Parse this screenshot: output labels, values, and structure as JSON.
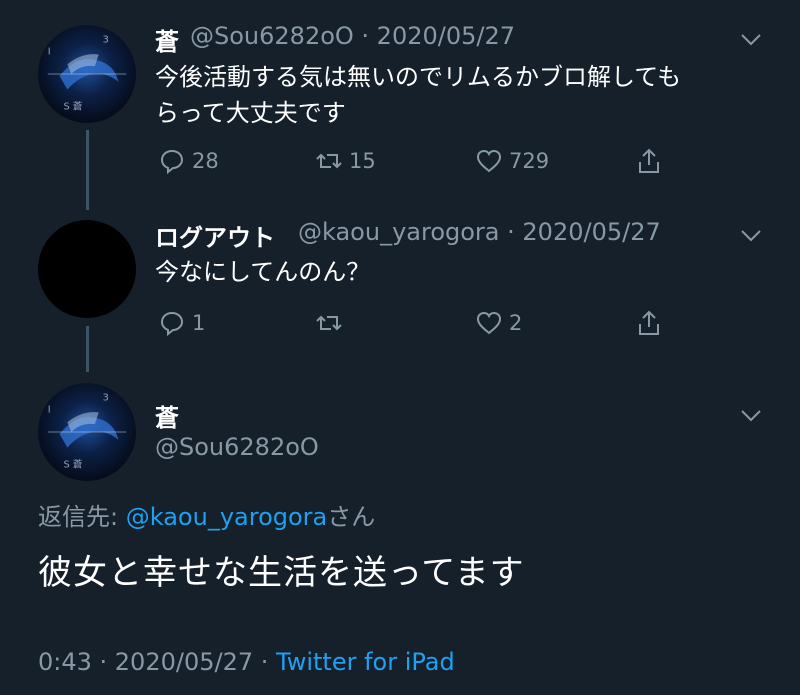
{
  "tweet1": {
    "name": "蒼",
    "handle": "@Sou6282oO",
    "date": "· 2020/05/27",
    "line1": "今後活動する気は無いのでリムるかブロ解しても",
    "line2": "らって大丈夫です",
    "reply_count": "28",
    "retweet_count": "15",
    "like_count": "729"
  },
  "tweet2": {
    "name": "ログアウト",
    "handle": "@kaou_yarogora",
    "date": "· 2020/05/27",
    "text": "今なにしてんのん？",
    "reply_count": "1",
    "retweet_count": "",
    "like_count": "2"
  },
  "main_tweet": {
    "name": "蒼",
    "handle": "@Sou6282oO",
    "replying_prefix": "返信先:",
    "replying_user": "@kaou_yarogora",
    "replying_suffix": "さん",
    "text": "彼女と幸せな生活を送ってます",
    "time": "0:43 · 2020/05/27 ·",
    "client": "Twitter for iPad"
  },
  "colors": {
    "background": "#15202b",
    "muted": "#8899a6",
    "accent": "#1da1f2",
    "thread_line": "#3d5466"
  },
  "icons": [
    "chevron-down-icon",
    "reply-icon",
    "retweet-icon",
    "like-icon",
    "share-icon"
  ]
}
